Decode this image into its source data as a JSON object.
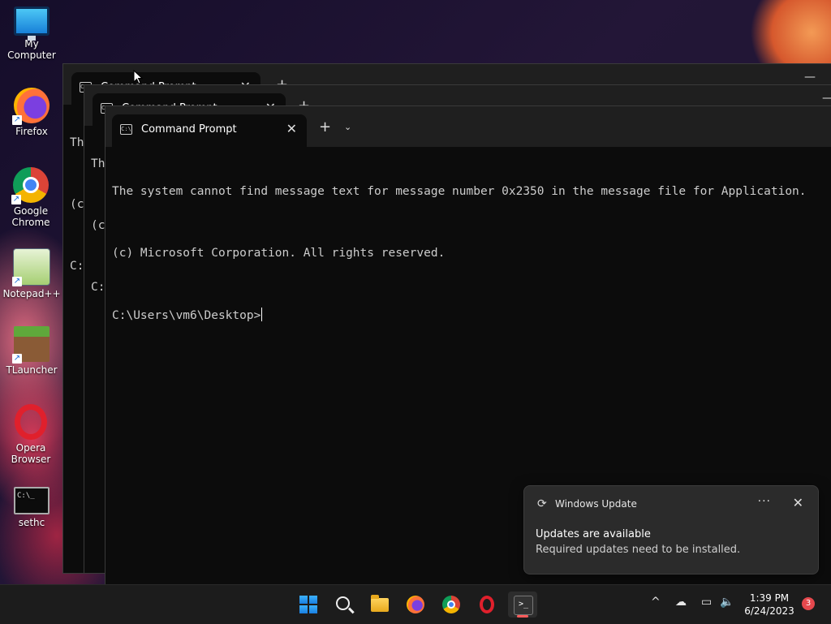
{
  "desktop": {
    "icons": [
      {
        "label": "My Computer"
      },
      {
        "label": "Firefox"
      },
      {
        "label": "Google Chrome"
      },
      {
        "label": "Notepad++"
      },
      {
        "label": "TLauncher"
      },
      {
        "label": "Opera Browser"
      },
      {
        "label": "sethc"
      }
    ]
  },
  "windows": {
    "back": {
      "tab_title": "Command Prompt",
      "partial_lines": [
        "Th",
        "(c",
        "C:"
      ]
    },
    "middle": {
      "tab_title": "Command Prompt",
      "partial_lines": [
        "Th",
        "(c",
        "C:"
      ]
    },
    "front": {
      "tab_title": "Command Prompt",
      "tab_icon": "C:\\",
      "lines": [
        "The system cannot find message text for message number 0x2350 in the message file for Application.",
        "(c) Microsoft Corporation. All rights reserved.",
        "C:\\Users\\vm6\\Desktop>"
      ]
    },
    "new_tab_glyph": "+",
    "dropdown_glyph": "⌄",
    "close_glyph": "✕",
    "min_glyph": "—"
  },
  "toast": {
    "source": "Windows Update",
    "title": "Updates are available",
    "body": "Required updates need to be installed.",
    "more_glyph": "···",
    "close_glyph": "✕",
    "sync_glyph": "⟳"
  },
  "taskbar": {
    "time": "1:39 PM",
    "date": "6/24/2023",
    "notification_count": "3",
    "term_glyph": ">_",
    "chevron_glyph": "^",
    "cloud_glyph": "☁",
    "network_glyph": "▭",
    "volume_glyph": "🔈"
  }
}
